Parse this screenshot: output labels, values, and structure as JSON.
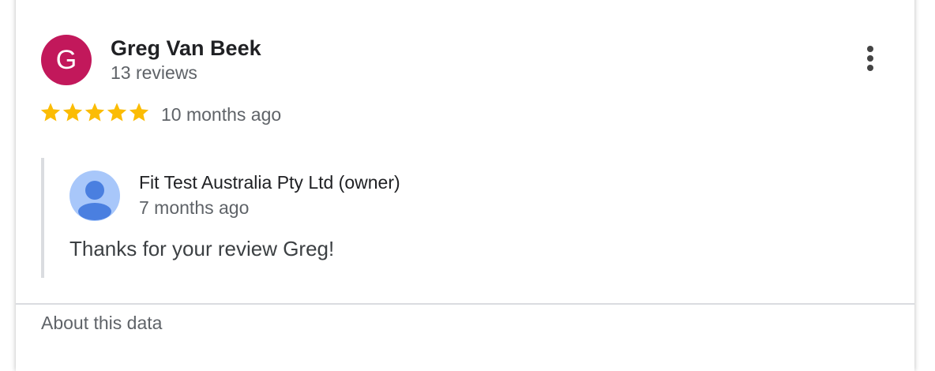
{
  "review": {
    "avatar_letter": "G",
    "avatar_color": "#c2185b",
    "reviewer_name": "Greg Van Beek",
    "review_count": "13 reviews",
    "rating": 5,
    "rating_max": 5,
    "star_color": "#fbbc04",
    "time": "10 months ago",
    "more_icon": "more-vert-icon"
  },
  "reply": {
    "owner_name": "Fit Test Australia Pty Ltd (owner)",
    "time": "7 months ago",
    "text": "Thanks for your review Greg!",
    "avatar_icon": "default-profile-icon"
  },
  "footer": {
    "about_label": "About this data"
  }
}
